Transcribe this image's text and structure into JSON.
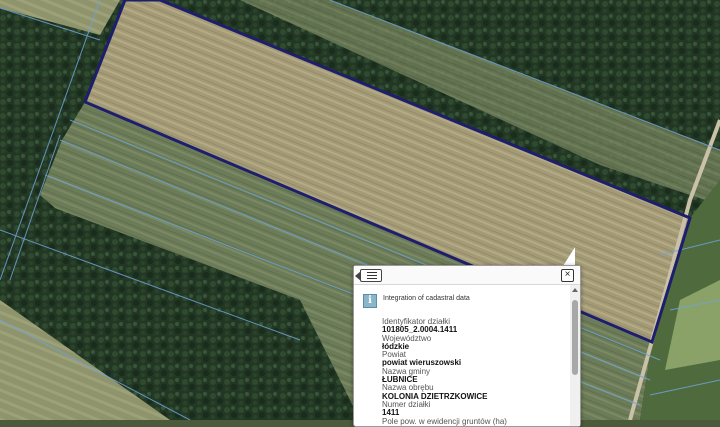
{
  "map": {
    "parcel_outline_color": "#1e1e6e",
    "boundary_line_color": "#6fa3d8"
  },
  "popup": {
    "list_icon": "list-back-icon",
    "close_icon": "close-icon",
    "close_glyph": "×",
    "info_icon": "info-icon",
    "info_glyph": "i",
    "section_title": "Integration of cadastral data",
    "attributes": [
      {
        "label": "Identyfikator działki",
        "value": "101805_2.0004.1411"
      },
      {
        "label": "Województwo",
        "value": "łódzkie"
      },
      {
        "label": "Powiat",
        "value": "powiat wieruszowski"
      },
      {
        "label": "Nazwa gminy",
        "value": "ŁUBNICE"
      },
      {
        "label": "Nazwa obrębu",
        "value": "KOLONIA DZIETRZKOWICE"
      },
      {
        "label": "Numer działki",
        "value": "1411"
      },
      {
        "label": "Pole pow. w ewidencji gruntów (ha)",
        "value": ""
      }
    ]
  }
}
